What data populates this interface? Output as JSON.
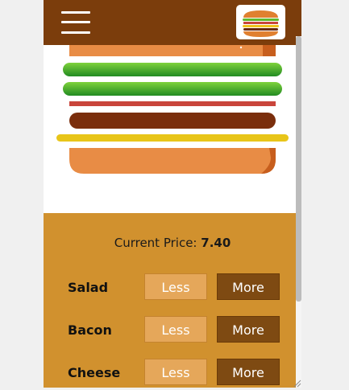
{
  "header": {
    "menu_icon": "hamburger-menu-icon",
    "logo_icon": "burger-logo-icon"
  },
  "burger": {
    "layers": [
      "bread-top",
      "salad",
      "salad",
      "bacon",
      "meat",
      "cheese",
      "bread-bottom"
    ]
  },
  "price": {
    "label": "Current Price:",
    "value": "7.40"
  },
  "ingredients": [
    {
      "name": "Salad",
      "less_label": "Less",
      "more_label": "More"
    },
    {
      "name": "Bacon",
      "less_label": "Less",
      "more_label": "More"
    },
    {
      "name": "Cheese",
      "less_label": "Less",
      "more_label": "More"
    }
  ],
  "colors": {
    "header": "#7b3d0c",
    "controls_bg": "#d1912e",
    "less_button": "#e5a75a",
    "more_button": "#7e4a12"
  }
}
